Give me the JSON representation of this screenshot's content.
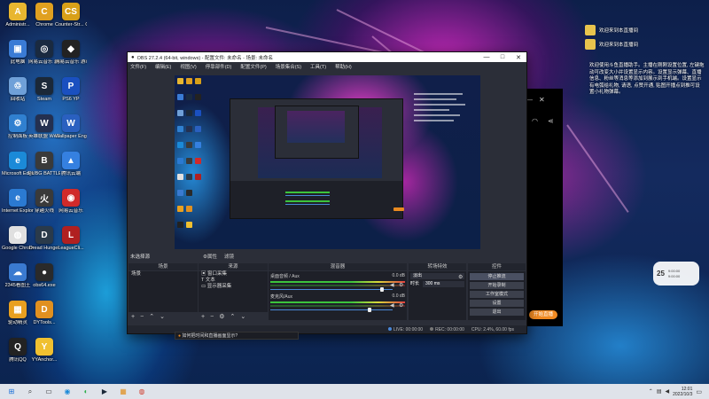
{
  "desktop_icons": [
    {
      "label": "Administr...",
      "color": "#e8b630",
      "glyph": "A"
    },
    {
      "label": "Chrome",
      "color": "#e0a020",
      "glyph": "C"
    },
    {
      "label": "Counter-Str... Global Offe...",
      "color": "#d8a018",
      "glyph": "CS"
    },
    {
      "label": "此电脑",
      "color": "#3a7bd5",
      "glyph": "▣"
    },
    {
      "label": "网易云音乐 游戏直播",
      "color": "#1a2a40",
      "glyph": "◎"
    },
    {
      "label": "网易云音乐 游戏助手",
      "color": "#222",
      "glyph": "◆"
    },
    {
      "label": "回收站",
      "color": "#6fa0d8",
      "glyph": "♲"
    },
    {
      "label": "Steam",
      "color": "#1b2838",
      "glyph": "S"
    },
    {
      "label": "PS6 YP",
      "color": "#1a50c0",
      "glyph": "P"
    },
    {
      "label": "控制面板",
      "color": "#3080d0",
      "glyph": "⚙"
    },
    {
      "label": "英雄联盟 WeGame",
      "color": "#243050",
      "glyph": "W"
    },
    {
      "label": "Wallpaper Engine",
      "color": "#2a60c0",
      "glyph": "W"
    },
    {
      "label": "Microsoft Edge",
      "color": "#1b8ad8",
      "glyph": "e"
    },
    {
      "label": "PUBG BATTLEG...",
      "color": "#3a3a3a",
      "glyph": "B"
    },
    {
      "label": "腾讯云端",
      "color": "#3580e0",
      "glyph": "▲"
    },
    {
      "label": "Internet Explorer",
      "color": "#2b7ad2",
      "glyph": "e"
    },
    {
      "label": "穿越火线",
      "color": "#3a3a3a",
      "glyph": "火"
    },
    {
      "label": "网易云音乐",
      "color": "#d02a2a",
      "glyph": "◉"
    },
    {
      "label": "Google Chrome",
      "color": "#e0e0e0",
      "glyph": "◍"
    },
    {
      "label": "Dread Hunger",
      "color": "#2a3a4a",
      "glyph": "D"
    },
    {
      "label": "LeagueCli...",
      "color": "#b02020",
      "glyph": "L"
    },
    {
      "label": "2345看图王",
      "color": "#3a7ad0",
      "glyph": "☁"
    },
    {
      "label": "obs64.exe",
      "color": "#2a2a2a",
      "glyph": "●"
    },
    {
      "label": "",
      "color": "",
      "glyph": ""
    },
    {
      "label": "驱动精灵",
      "color": "#e8a020",
      "glyph": "▦"
    },
    {
      "label": "DYTools...",
      "color": "#e09020",
      "glyph": "D"
    },
    {
      "label": "",
      "color": "",
      "glyph": ""
    },
    {
      "label": "腾讯QQ",
      "color": "#222",
      "glyph": "Q"
    },
    {
      "label": "YYAnchor...",
      "color": "#f0c030",
      "glyph": "Y"
    }
  ],
  "obs": {
    "title": "OBS 27.2.4 (64-bit, windows) - 配置文件: 未命名 - 场景: 未命名",
    "menu": [
      "文件(F)",
      "编辑(E)",
      "视图(V)",
      "停靠部件(D)",
      "配置文件(P)",
      "场景集合(S)",
      "工具(T)",
      "帮助(H)"
    ],
    "scene_label": "未选择源",
    "props_tabs": [
      "⚙属性",
      "滤镜"
    ],
    "docks": {
      "scenes": {
        "title": "场景",
        "items": [
          "场景"
        ]
      },
      "sources": {
        "title": "来源",
        "items": [
          "窗口采集",
          "文本",
          "显示器采集"
        ]
      },
      "mixer": {
        "title": "混音器",
        "channels": [
          {
            "name": "桌面音频 / Aux",
            "db": "0.0 dB"
          },
          {
            "name": "麦克风/Aux",
            "db": "0.0 dB"
          }
        ]
      },
      "transitions": {
        "title": "转场特效",
        "type": "淡出",
        "duration_label": "时长",
        "duration": "300 ms"
      },
      "controls": {
        "title": "控件",
        "buttons": [
          "停止推流",
          "开始录制",
          "工作室模式",
          "设置",
          "退出"
        ]
      }
    },
    "status": {
      "live": "LIVE: 00:00:00",
      "rec": "REC: 00:00:00",
      "cpu": "CPU: 2.4%, 60.00 fps"
    }
  },
  "notification": "如何把时间和直播画面显示?",
  "chat": {
    "messages": [
      "欢迎来到本直播间",
      "欢迎来到本直播间"
    ],
    "body": "欢迎使用斗鱼直播助手。主播在刚刚设置位置, 左键拖动可改变大小并设置显示内容。设置显示弹幕、直播信息、粉丝等消息等添加到展示到手机端。设置显示有电弧给礼物, 请语, 点赞开通, 贴图开播点到推可设置小礼物弹幕。"
  },
  "weather": {
    "temp": "25",
    "line1": "9:00:00",
    "line2": "9:00:00"
  },
  "start_live": "开始直播",
  "taskbar": {
    "time": "12:01",
    "date": "2022/10/3",
    "apps": [
      "⊞",
      "⌕",
      "▭",
      "◉",
      "◐",
      "▶",
      "▦",
      "◍"
    ]
  }
}
